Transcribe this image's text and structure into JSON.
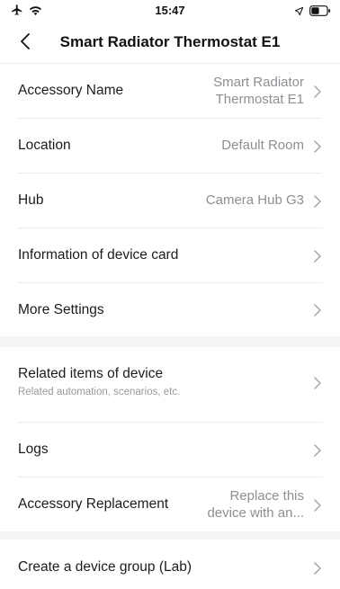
{
  "status_bar": {
    "time": "15:47",
    "left_icons": [
      "airplane-icon",
      "wifi-icon"
    ],
    "right_icons": [
      "location-arrow-icon",
      "battery-icon"
    ]
  },
  "nav": {
    "title": "Smart Radiator Thermostat E1",
    "back_icon": "chevron-left-icon"
  },
  "rows": [
    {
      "label": "Accessory Name",
      "value_line1": "Smart Radiator",
      "value_line2": "Thermostat E1"
    },
    {
      "label": "Location",
      "value": "Default Room"
    },
    {
      "label": "Hub",
      "value": "Camera Hub G3"
    },
    {
      "label": "Information of device card",
      "value": ""
    },
    {
      "label": "More Settings",
      "value": ""
    },
    {
      "label": "Related items of device",
      "sublabel": "Related automation, scenarios, etc."
    },
    {
      "label": "Logs",
      "value": ""
    },
    {
      "label": "Accessory Replacement",
      "value_line1": "Replace this",
      "value_line2": "device with an..."
    },
    {
      "label": "Create a device group (Lab)",
      "value": ""
    }
  ],
  "colors": {
    "background": "#ffffff",
    "section_gap": "#f4f4f6",
    "divider": "#ececec",
    "secondary_text": "#8e8e93",
    "primary_text": "#1c1c1e"
  }
}
